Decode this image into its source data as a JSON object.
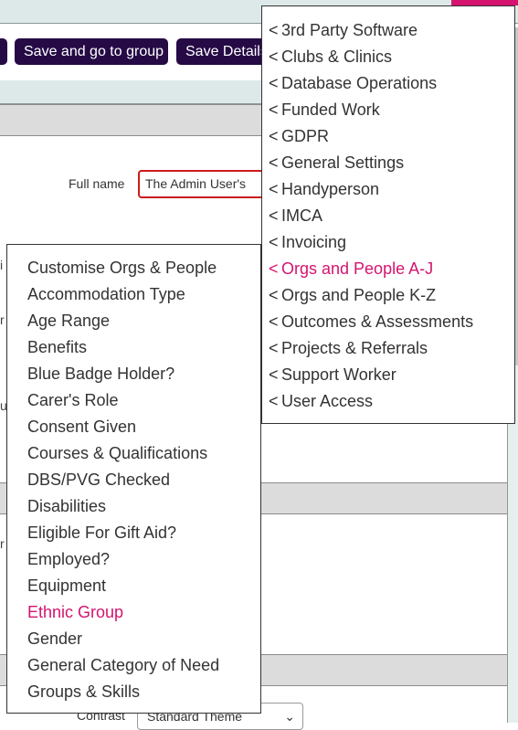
{
  "toolbar": {
    "buttons": [
      {
        "label": ""
      },
      {
        "label": "Save and go to group"
      },
      {
        "label": "Save Details"
      }
    ]
  },
  "form": {
    "full_name": {
      "label": "Full name",
      "value": "The Admin User's"
    },
    "contrast": {
      "label": "Contrast",
      "value": "Standard Theme"
    },
    "edge_fragments": [
      "i",
      "r",
      "u",
      "r"
    ]
  },
  "menu_categories": {
    "items": [
      {
        "label": "3rd Party Software",
        "active": false
      },
      {
        "label": "Clubs & Clinics",
        "active": false
      },
      {
        "label": "Database Operations",
        "active": false
      },
      {
        "label": "Funded Work",
        "active": false
      },
      {
        "label": "GDPR",
        "active": false
      },
      {
        "label": "General Settings",
        "active": false
      },
      {
        "label": "Handyperson",
        "active": false
      },
      {
        "label": "IMCA",
        "active": false
      },
      {
        "label": "Invoicing",
        "active": false
      },
      {
        "label": "Orgs and People A-J",
        "active": true
      },
      {
        "label": "Orgs and People K-Z",
        "active": false
      },
      {
        "label": "Outcomes & Assessments",
        "active": false
      },
      {
        "label": "Projects & Referrals",
        "active": false
      },
      {
        "label": "Support Worker",
        "active": false
      },
      {
        "label": "User Access",
        "active": false
      }
    ],
    "prefix": "<"
  },
  "menu_submenu": {
    "items": [
      {
        "label": "Customise Orgs & People",
        "active": false
      },
      {
        "label": "Accommodation Type",
        "active": false
      },
      {
        "label": "Age Range",
        "active": false
      },
      {
        "label": "Benefits",
        "active": false
      },
      {
        "label": "Blue Badge Holder?",
        "active": false
      },
      {
        "label": "Carer's Role",
        "active": false
      },
      {
        "label": "Consent Given",
        "active": false
      },
      {
        "label": "Courses & Qualifications",
        "active": false
      },
      {
        "label": "DBS/PVG Checked",
        "active": false
      },
      {
        "label": "Disabilities",
        "active": false
      },
      {
        "label": "Eligible For Gift Aid?",
        "active": false
      },
      {
        "label": "Employed?",
        "active": false
      },
      {
        "label": "Equipment",
        "active": false
      },
      {
        "label": "Ethnic Group",
        "active": true
      },
      {
        "label": "Gender",
        "active": false
      },
      {
        "label": "General Category of Need",
        "active": false
      },
      {
        "label": "Groups & Skills",
        "active": false
      }
    ]
  },
  "colors": {
    "accent": "#d4146e",
    "button_bg": "#250a45",
    "error_border": "#cc1a1a"
  },
  "icons": {
    "chevron": "chevron-down-icon"
  }
}
